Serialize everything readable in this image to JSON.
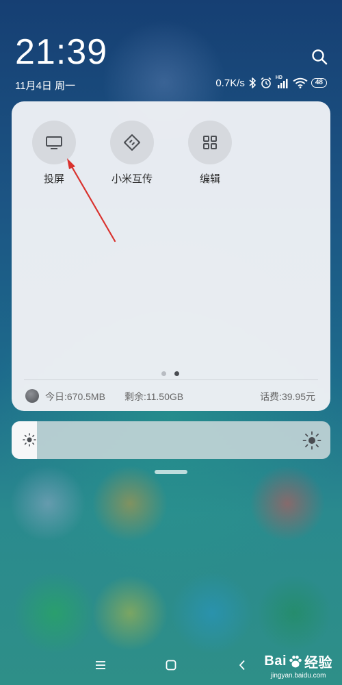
{
  "status_bar": {
    "time": "21:39",
    "date": "11月4日 周一",
    "net_speed": "0.7K/s",
    "hd_label": "HD",
    "battery": "48"
  },
  "control_center": {
    "tiles": [
      {
        "label": "投屏",
        "icon": "cast-screen-icon"
      },
      {
        "label": "小米互传",
        "icon": "mi-share-icon"
      },
      {
        "label": "编辑",
        "icon": "grid-edit-icon"
      }
    ],
    "page_dots": 2,
    "active_page": 2,
    "data_usage": {
      "used": "今日:670.5MB",
      "remaining": "剩余:11.50GB",
      "fee": "话费:39.95元"
    }
  },
  "brightness": {
    "level": 0.08
  },
  "watermark": {
    "brand_left": "Bai",
    "brand_right": "经验",
    "url": "jingyan.baidu.com"
  },
  "colors": {
    "annotation_arrow": "#d9322e",
    "panel_bg": "#eef1f5",
    "tile_bg": "#d6d9de"
  }
}
